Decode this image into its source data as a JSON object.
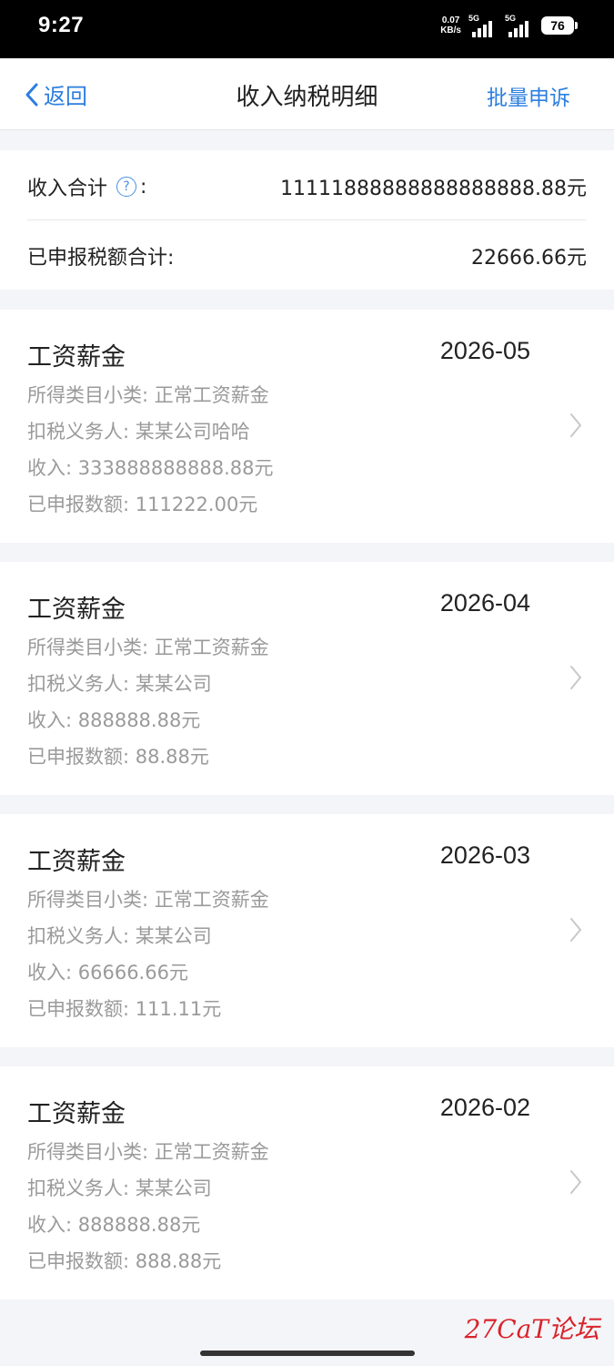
{
  "status_bar": {
    "time": "9:27",
    "net_speed_value": "0.07",
    "net_speed_unit": "KB/s",
    "signal1_label": "5G",
    "signal2_label": "5G",
    "battery": "76",
    "battery_icon": "battery-icon",
    "signal_icon": "signal-icon"
  },
  "nav": {
    "back_label": "返回",
    "back_icon": "chevron-left-icon",
    "title": "收入纳税明细",
    "action_label": "批量申诉",
    "accent_color": "#2b7ee0"
  },
  "summary": {
    "income_label": "收入合计",
    "income_colon": ":",
    "help_icon": "question-circle-icon",
    "help_glyph": "?",
    "income_value": "11111888888888888888.88元",
    "tax_label": "已申报税额合计:",
    "tax_value": "22666.66元"
  },
  "records": [
    {
      "title": "工资薪金",
      "date": "2026-05",
      "subcategory": "所得类目小类: 正常工资薪金",
      "withholder": "扣税义务人: 某某公司哈哈",
      "income": "收入: 333888888888.88元",
      "declared": "已申报数额: 111222.00元"
    },
    {
      "title": "工资薪金",
      "date": "2026-04",
      "subcategory": "所得类目小类: 正常工资薪金",
      "withholder": "扣税义务人: 某某公司",
      "income": "收入: 888888.88元",
      "declared": "已申报数额: 88.88元"
    },
    {
      "title": "工资薪金",
      "date": "2026-03",
      "subcategory": "所得类目小类: 正常工资薪金",
      "withholder": "扣税义务人: 某某公司",
      "income": "收入: 66666.66元",
      "declared": "已申报数额: 111.11元"
    },
    {
      "title": "工资薪金",
      "date": "2026-02",
      "subcategory": "所得类目小类: 正常工资薪金",
      "withholder": "扣税义务人: 某某公司",
      "income": "收入: 888888.88元",
      "declared": "已申报数额: 888.88元"
    }
  ],
  "watermark": "27CaT论坛"
}
